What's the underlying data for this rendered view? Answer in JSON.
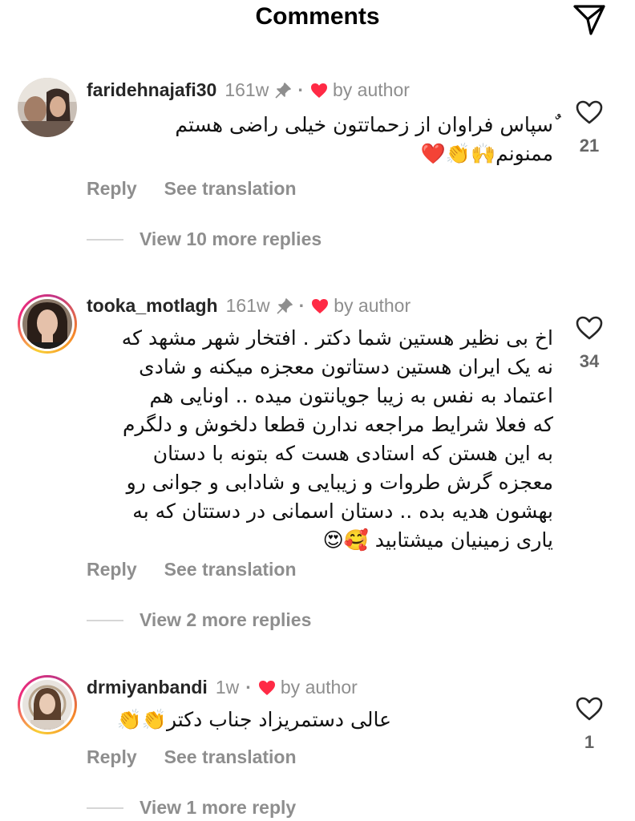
{
  "header": {
    "title": "Comments",
    "share_icon": "paper-plane-icon"
  },
  "comments": [
    {
      "username": "faridehnajafi30",
      "time": "161w",
      "pinned": true,
      "dot": "·",
      "author_liked": "by author",
      "body_lines": [
        "ٌسپاس فراوان از زحماتتون خیلی راضی هستم",
        "ممنونم🙌👏❤️"
      ],
      "reply_label": "Reply",
      "translation_label": "See translation",
      "like_count": "21",
      "view_more": "View 10 more replies"
    },
    {
      "username": "tooka_motlagh",
      "time": "161w",
      "pinned": true,
      "dot": "·",
      "author_liked": "by author",
      "body_lines": [
        "اخ بی نظیر هستین شما دکتر . افتخار شهر مشهد که",
        "نه یک ایران هستین دستاتون معجزه میکنه و شادی",
        "اعتماد به نفس به زیبا جویانتون میده .. اونایی هم",
        "که فعلا شرایط مراجعه ندارن  قطعا دلخوش و دلگرم",
        "به این هستن که استادی هست که بتونه با دستان",
        "معجزه گرش طروات و زیبایی و شادابی و جوانی رو",
        "بهشون هدیه بده .. دستان اسمانی در دستتان که به",
        "یاری زمینیان میشتابید 🥰😍"
      ],
      "reply_label": "Reply",
      "translation_label": "See translation",
      "like_count": "34",
      "view_more": "View 2 more replies"
    },
    {
      "username": "drmiyanbandi",
      "time": "1w",
      "pinned": false,
      "dot": "·",
      "author_liked": "by author",
      "body_lines": [
        "عالی دستمریزاد جناب دکتر👏👏"
      ],
      "reply_label": "Reply",
      "translation_label": "See translation",
      "like_count": "1",
      "view_more": "View 1 more reply"
    }
  ],
  "colors": {
    "text_primary": "#262626",
    "text_secondary": "#8e8e8e",
    "heart_red": "#ff2a45",
    "story_ring": [
      "#f9ce34",
      "#ee2a7b",
      "#c13584"
    ]
  }
}
